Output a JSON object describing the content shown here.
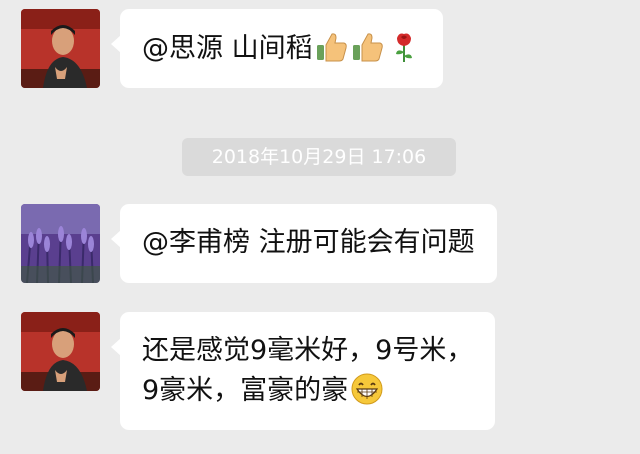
{
  "chat": {
    "timestamp": "2018年10月29日 17:06",
    "messages": [
      {
        "avatar": "man-red-background",
        "lines": [
          "@思源 山间稻"
        ],
        "emoji": [
          "thumbs-up",
          "thumbs-up",
          "rose"
        ]
      },
      {
        "avatar": "lavender-field",
        "lines": [
          "@李甫榜 注册可能会有问题"
        ],
        "emoji": []
      },
      {
        "avatar": "man-red-background",
        "lines": [
          "还是感觉9毫米好，9号米，",
          "9豪米，富豪的豪"
        ],
        "emoji": [
          "grinning-face"
        ]
      }
    ]
  },
  "colors": {
    "background": "#ebebeb",
    "bubble": "#ffffff",
    "timestamp_pill": "#dadada"
  }
}
